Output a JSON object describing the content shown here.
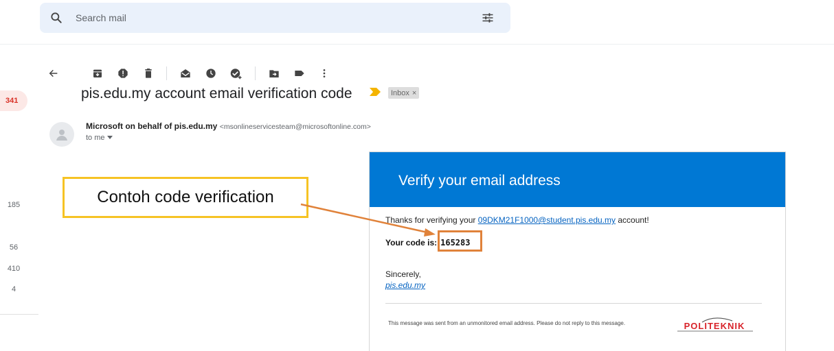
{
  "search": {
    "placeholder": "Search mail",
    "value": ""
  },
  "toolbar": {
    "icons": [
      "back-arrow-icon",
      "archive-icon",
      "report-spam-icon",
      "delete-icon",
      "mark-unread-icon",
      "snooze-icon",
      "add-task-icon",
      "move-to-icon",
      "label-icon",
      "more-vert-icon"
    ]
  },
  "nav": {
    "badge": "341",
    "counts": [
      "185",
      "56",
      "410",
      "4"
    ]
  },
  "email": {
    "subject": "pis.edu.my account email verification code",
    "label": "Inbox",
    "label_remove": "×",
    "sender_name": "Microsoft on behalf of pis.edu.my",
    "sender_email": "<msonlineservicesteam@microsoftonline.com>",
    "to": "to me"
  },
  "body": {
    "title": "Verify your email address",
    "line1_before": "Thanks for verifying your ",
    "line1_link": "09DKM21F1000@student.pis.edu.my",
    "line1_after": " account!",
    "code_label": "Your code is:",
    "code": "165283",
    "sincerely": "Sincerely,",
    "sign_link": "pis.edu.my",
    "footer": "This message was sent from an unmonitored email address. Please do not reply to this message.",
    "logo_text": "POLITEKNIK"
  },
  "annotation": {
    "callout": "Contoh code verification"
  },
  "colors": {
    "header_blue": "#0078d4",
    "callout_border": "#f6c324",
    "arrow": "#e0823a",
    "link": "#0563c1"
  }
}
